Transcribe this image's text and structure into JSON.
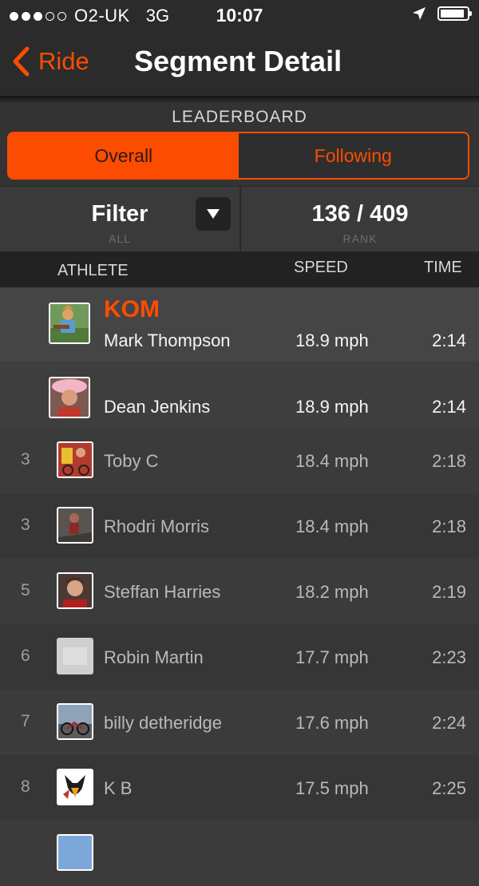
{
  "status_bar": {
    "carrier": "O2-UK",
    "network": "3G",
    "time": "10:07",
    "signal_bars_filled": 3,
    "signal_bars_total": 5,
    "battery_level": 0.9,
    "location_icon": "location-arrow-icon"
  },
  "nav": {
    "back_label": "Ride",
    "title": "Segment Detail"
  },
  "leaderboard": {
    "heading": "LEADERBOARD",
    "tabs": [
      {
        "label": "Overall",
        "active": true
      },
      {
        "label": "Following",
        "active": false
      }
    ]
  },
  "filter": {
    "label": "Filter",
    "value": "ALL",
    "rank_value": "136 / 409",
    "rank_label": "RANK"
  },
  "columns": {
    "athlete": "ATHLETE",
    "speed": "SPEED",
    "time": "TIME"
  },
  "rows": [
    {
      "rank": "",
      "badge": "KOM",
      "name": "Mark Thompson",
      "speed": "18.9 mph",
      "time": "2:14"
    },
    {
      "rank": "",
      "badge": "",
      "name": "Dean Jenkins",
      "speed": "18.9 mph",
      "time": "2:14"
    },
    {
      "rank": "3",
      "name": "Toby C",
      "speed": "18.4 mph",
      "time": "2:18"
    },
    {
      "rank": "3",
      "name": "Rhodri Morris",
      "speed": "18.4 mph",
      "time": "2:18"
    },
    {
      "rank": "5",
      "name": "Steffan Harries",
      "speed": "18.2 mph",
      "time": "2:19"
    },
    {
      "rank": "6",
      "name": "Robin Martin",
      "speed": "17.7 mph",
      "time": "2:23"
    },
    {
      "rank": "7",
      "name": "billy detheridge",
      "speed": "17.6 mph",
      "time": "2:24"
    },
    {
      "rank": "8",
      "name": "K B",
      "speed": "17.5 mph",
      "time": "2:25"
    }
  ],
  "colors": {
    "accent": "#fc4c02",
    "background": "#333333",
    "header": "#222222"
  }
}
